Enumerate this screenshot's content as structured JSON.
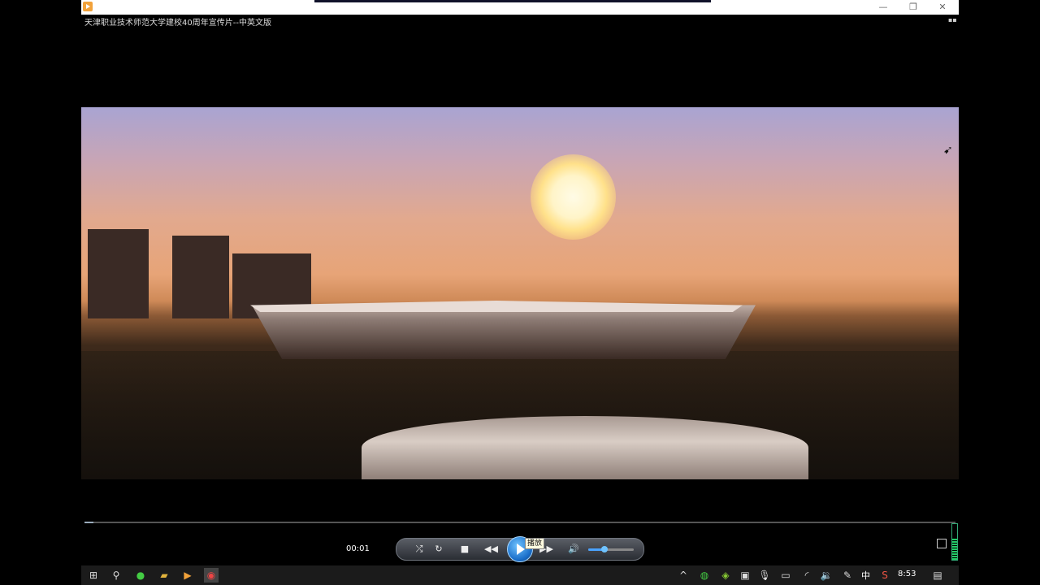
{
  "window": {
    "title": "天津职业技术师范大学建校40周年宣传片--中英文版",
    "buttons": {
      "minimize": "—",
      "maximize": "❐",
      "close": "✕"
    }
  },
  "player": {
    "current_time": "00:01",
    "progress_fraction": 0.01,
    "volume_fraction": 0.35,
    "play_tooltip": "播放",
    "controls": [
      "shuffle",
      "repeat",
      "stop",
      "previous",
      "play",
      "next",
      "mute"
    ]
  },
  "taskbar": {
    "ime": "中",
    "clock": "8:53"
  }
}
